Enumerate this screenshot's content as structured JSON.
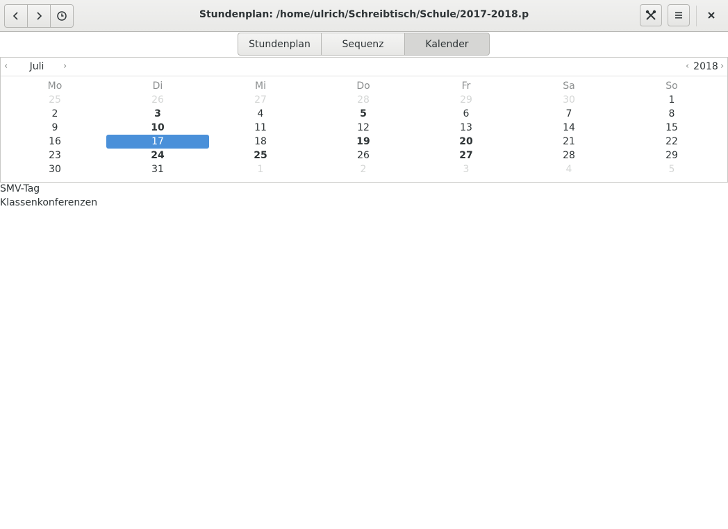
{
  "window": {
    "title": "Stundenplan: /home/ulrich/Schreibtisch/Schule/2017-2018.p"
  },
  "icons": {
    "back": "chevron-left-icon",
    "forward": "chevron-right-icon",
    "history": "clock-icon",
    "tools": "tools-icon",
    "menu": "hamburger-menu-icon",
    "close": "close-icon"
  },
  "tabs": [
    {
      "label": "Stundenplan",
      "active": false
    },
    {
      "label": "Sequenz",
      "active": false
    },
    {
      "label": "Kalender",
      "active": true
    }
  ],
  "calendar": {
    "month": "Juli",
    "year": "2018",
    "weekdays": [
      "Mo",
      "Di",
      "Mi",
      "Do",
      "Fr",
      "Sa",
      "So"
    ],
    "weeks": [
      [
        "25",
        "26",
        "27",
        "28",
        "29",
        "30",
        "1"
      ],
      [
        "2",
        "3",
        "4",
        "5",
        "6",
        "7",
        "8"
      ],
      [
        "9",
        "10",
        "11",
        "12",
        "13",
        "14",
        "15"
      ],
      [
        "16",
        "17",
        "18",
        "19",
        "20",
        "21",
        "22"
      ],
      [
        "23",
        "24",
        "25",
        "26",
        "27",
        "28",
        "29"
      ],
      [
        "30",
        "31",
        "1",
        "2",
        "3",
        "4",
        "5"
      ]
    ],
    "other_month": [
      [
        true,
        true,
        true,
        true,
        true,
        true,
        false
      ],
      [
        false,
        false,
        false,
        false,
        false,
        false,
        false
      ],
      [
        false,
        false,
        false,
        false,
        false,
        false,
        false
      ],
      [
        false,
        false,
        false,
        false,
        false,
        false,
        false
      ],
      [
        false,
        false,
        false,
        false,
        false,
        false,
        false
      ],
      [
        false,
        false,
        true,
        true,
        true,
        true,
        true
      ]
    ],
    "marked_days": [
      "3",
      "5",
      "10",
      "19",
      "20",
      "24",
      "25",
      "27"
    ],
    "selected_day": "17",
    "selection_color": "#4a90d9"
  },
  "events": [
    "SMV-Tag",
    "Klassenkonferenzen"
  ]
}
